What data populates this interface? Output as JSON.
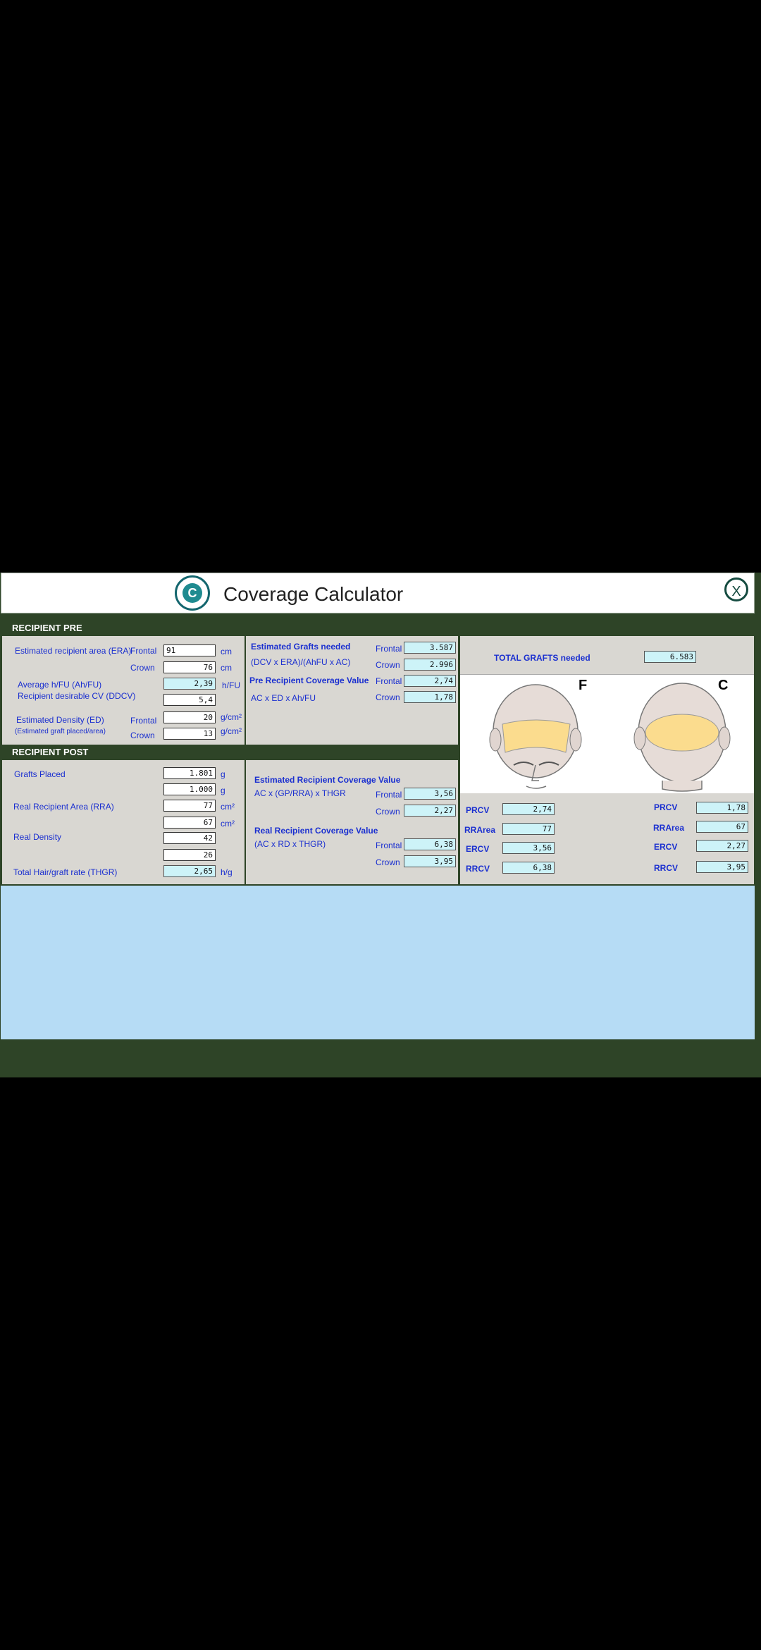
{
  "window": {
    "title": "Coverage Calculator",
    "close_label": "X"
  },
  "recipient_pre": {
    "header": "RECIPIENT PRE",
    "era_label": "Estimated recipient area (ERA)",
    "frontal": "Frontal",
    "crown": "Crown",
    "era_frontal": "91",
    "era_crown": "76",
    "unit_cm": "cm",
    "ahfu_label": "Average h/FU (Ah/FU)",
    "ahfu_value": "2,39",
    "ahfu_unit": "h/FU",
    "ddcv_label": "Recipient desirable CV (DDCV)",
    "ddcv_value": "5,4",
    "ed_label": "Estimated Density (ED)",
    "ed_sublabel": "(Estimated graft placed/area)",
    "ed_frontal": "20",
    "ed_crown": "13",
    "unit_gcm2": "g/cm²"
  },
  "recipient_post": {
    "header": "RECIPIENT POST",
    "gp_label": "Grafts Placed",
    "gp_frontal": "1.801",
    "gp_crown": "1.000",
    "unit_g": "g",
    "rra_label": "Real Recipient Area (RRA)",
    "rra_frontal": "77",
    "rra_crown": "67",
    "unit_cm2": "cm²",
    "rd_label": "Real Density",
    "rd_frontal": "42",
    "rd_crown": "26",
    "thgr_label": "Total Hair/graft rate (THGR)",
    "thgr_value": "2,65",
    "thgr_unit": "h/g"
  },
  "middle_top": {
    "egn_label": "Estimated Grafts needed",
    "egn_formula": "(DCV x ERA)/(AhFU x AC)",
    "egn_frontal": "3.587",
    "egn_crown": "2.996",
    "prcv_label": "Pre Recipient Coverage Value",
    "prcv_formula": "AC x ED x Ah/FU",
    "prcv_frontal": "2,74",
    "prcv_crown": "1,78"
  },
  "middle_bottom": {
    "ercv_label": "Estimated Recipient Coverage Value",
    "ercv_formula": "AC x (GP/RRA) x THGR",
    "ercv_frontal": "3,56",
    "ercv_crown": "2,27",
    "rrcv_label": "Real Recipient Coverage Value",
    "rrcv_formula": "(AC x RD x THGR)",
    "rrcv_frontal": "6,38",
    "rrcv_crown": "3,95"
  },
  "right": {
    "total_label": "TOTAL GRAFTS needed",
    "total_value": "6.583",
    "head_f_letter": "F",
    "head_c_letter": "C",
    "left_labels": [
      "PRCV",
      "RRArea",
      "ERCV",
      "RRCV"
    ],
    "left_values": [
      "2,74",
      "77",
      "3,56",
      "6,38"
    ],
    "right_labels": [
      "PRCV",
      "RRArea",
      "ERCV",
      "RRCV"
    ],
    "right_values": [
      "1,78",
      "67",
      "2,27",
      "3,95"
    ],
    "colors": {
      "scalp_highlight": "#fbdc8e",
      "skin": "#e6dcd7"
    }
  }
}
